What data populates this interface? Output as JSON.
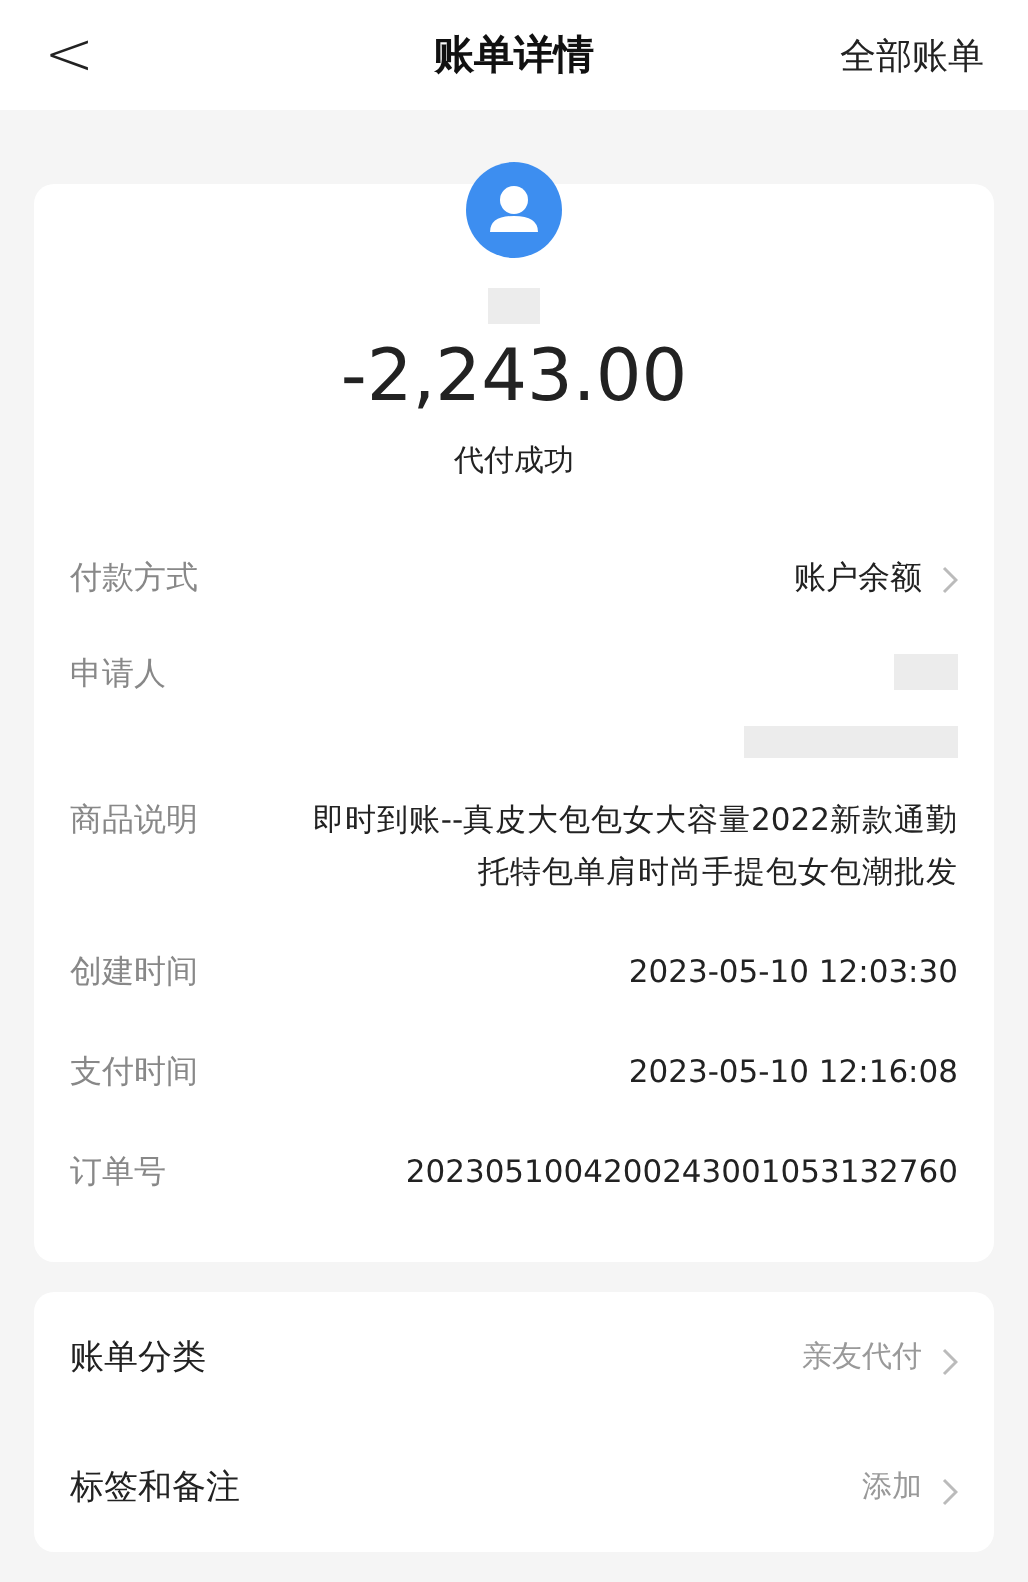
{
  "header": {
    "back": "<",
    "title": "账单详情",
    "action": "全部账单"
  },
  "summary": {
    "amount": "-2,243.00",
    "status": "代付成功"
  },
  "details": [
    {
      "kind": "link",
      "label": "付款方式",
      "value": "账户余额"
    },
    {
      "kind": "redacted",
      "label": "申请人"
    },
    {
      "kind": "text",
      "label": "商品说明",
      "value": "即时到账--真皮大包包女大容量2022新款通勤托特包单肩时尚手提包女包潮批发"
    },
    {
      "kind": "text",
      "label": "创建时间",
      "value": "2023-05-10 12:03:30"
    },
    {
      "kind": "text",
      "label": "支付时间",
      "value": "2023-05-10 12:16:08"
    },
    {
      "kind": "text",
      "label": "订单号",
      "value": "2023051004200243001053132760"
    }
  ],
  "options": [
    {
      "label": "账单分类",
      "value": "亲友代付"
    },
    {
      "label": "标签和备注",
      "value": "添加"
    }
  ]
}
